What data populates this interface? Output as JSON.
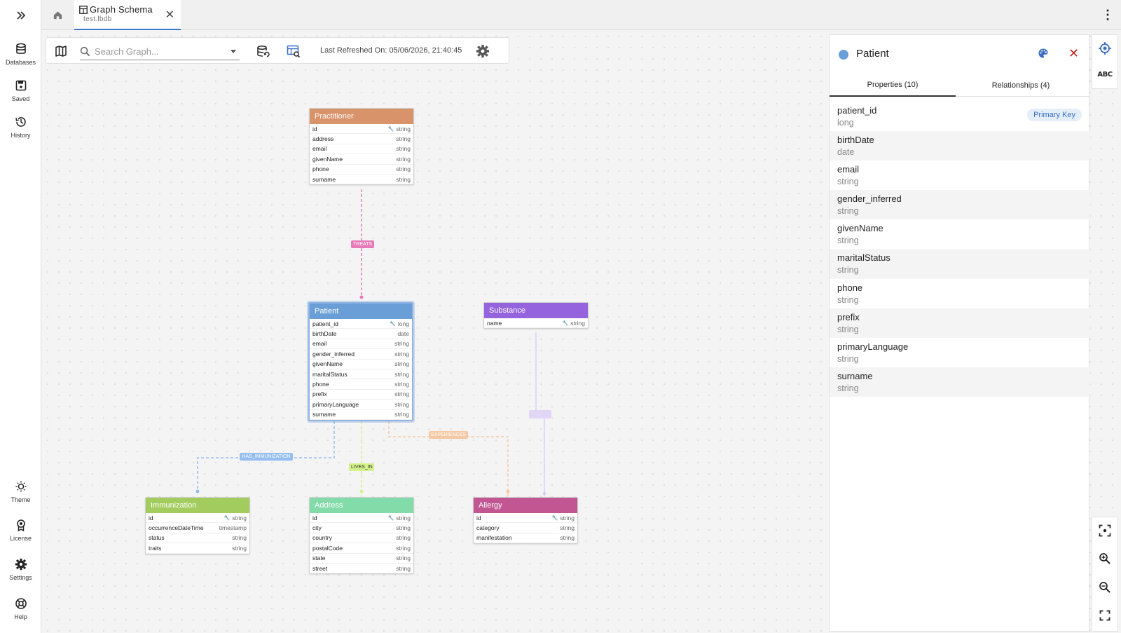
{
  "sidebar": {
    "items": [
      {
        "label": "Databases",
        "icon": "database-icon"
      },
      {
        "label": "Saved",
        "icon": "save-icon"
      },
      {
        "label": "History",
        "icon": "history-icon"
      }
    ],
    "bottom_items": [
      {
        "label": "Theme",
        "icon": "theme-icon"
      },
      {
        "label": "License",
        "icon": "license-icon"
      },
      {
        "label": "Settings",
        "icon": "gear-icon"
      },
      {
        "label": "Help",
        "icon": "help-icon"
      }
    ]
  },
  "tabs": {
    "active_title": "Graph Schema",
    "active_subtitle": "test.lbdb"
  },
  "toolbar": {
    "search_placeholder": "Search Graph...",
    "last_refreshed": "Last Refreshed On: 05/06/2026, 21:40:45"
  },
  "graph": {
    "nodes": {
      "practitioner": {
        "label": "Practitioner",
        "color": "#d9936a",
        "props": [
          {
            "name": "id",
            "type": "string",
            "key": true
          },
          {
            "name": "address",
            "type": "string"
          },
          {
            "name": "email",
            "type": "string"
          },
          {
            "name": "givenName",
            "type": "string"
          },
          {
            "name": "phone",
            "type": "string"
          },
          {
            "name": "surname",
            "type": "string"
          }
        ]
      },
      "patient": {
        "label": "Patient",
        "color": "#6a9ed6",
        "props": [
          {
            "name": "patient_id",
            "type": "long",
            "key": true
          },
          {
            "name": "birthDate",
            "type": "date"
          },
          {
            "name": "email",
            "type": "string"
          },
          {
            "name": "gender_inferred",
            "type": "string"
          },
          {
            "name": "givenName",
            "type": "string"
          },
          {
            "name": "maritalStatus",
            "type": "string"
          },
          {
            "name": "phone",
            "type": "string"
          },
          {
            "name": "prefix",
            "type": "string"
          },
          {
            "name": "primaryLanguage",
            "type": "string"
          },
          {
            "name": "surname",
            "type": "string"
          }
        ]
      },
      "substance": {
        "label": "Substance",
        "color": "#9463dd",
        "props": [
          {
            "name": "name",
            "type": "string",
            "key": true
          }
        ]
      },
      "immunization": {
        "label": "Immunization",
        "color": "#a3cc5e",
        "props": [
          {
            "name": "id",
            "type": "string",
            "key": true
          },
          {
            "name": "occurrenceDateTime",
            "type": "timestamp"
          },
          {
            "name": "status",
            "type": "string"
          },
          {
            "name": "traits",
            "type": "string"
          }
        ]
      },
      "address": {
        "label": "Address",
        "color": "#82dba8",
        "props": [
          {
            "name": "id",
            "type": "string",
            "key": true
          },
          {
            "name": "city",
            "type": "string"
          },
          {
            "name": "country",
            "type": "string"
          },
          {
            "name": "postalCode",
            "type": "string"
          },
          {
            "name": "state",
            "type": "string"
          },
          {
            "name": "street",
            "type": "string"
          }
        ]
      },
      "allergy": {
        "label": "Allergy",
        "color": "#c25692",
        "props": [
          {
            "name": "id",
            "type": "string",
            "key": true
          },
          {
            "name": "category",
            "type": "string"
          },
          {
            "name": "manifestation",
            "type": "string"
          }
        ]
      }
    },
    "edges": {
      "treats": {
        "label": "TREATS",
        "color": "#e77ab8"
      },
      "has_immunization": {
        "label": "HAS_IMMUNIZATION",
        "color": "#94bdf0"
      },
      "lives_in": {
        "label": "LIVES_IN",
        "color": "#d4f28a"
      },
      "experiences": {
        "label": "EXPERIENCES",
        "color": "#f6c9a4"
      },
      "substance_edge": {
        "label": "",
        "color": "#e2d6f7"
      }
    }
  },
  "panel": {
    "title": "Patient",
    "tab_properties": "Properties (10)",
    "tab_relationships": "Relationships (4)",
    "primary_key_badge": "Primary Key",
    "properties": [
      {
        "name": "patient_id",
        "type": "long"
      },
      {
        "name": "birthDate",
        "type": "date"
      },
      {
        "name": "email",
        "type": "string"
      },
      {
        "name": "gender_inferred",
        "type": "string"
      },
      {
        "name": "givenName",
        "type": "string"
      },
      {
        "name": "maritalStatus",
        "type": "string"
      },
      {
        "name": "phone",
        "type": "string"
      },
      {
        "name": "prefix",
        "type": "string"
      },
      {
        "name": "primaryLanguage",
        "type": "string"
      },
      {
        "name": "surname",
        "type": "string"
      }
    ]
  },
  "rail": {
    "abc_label": "ABC"
  }
}
